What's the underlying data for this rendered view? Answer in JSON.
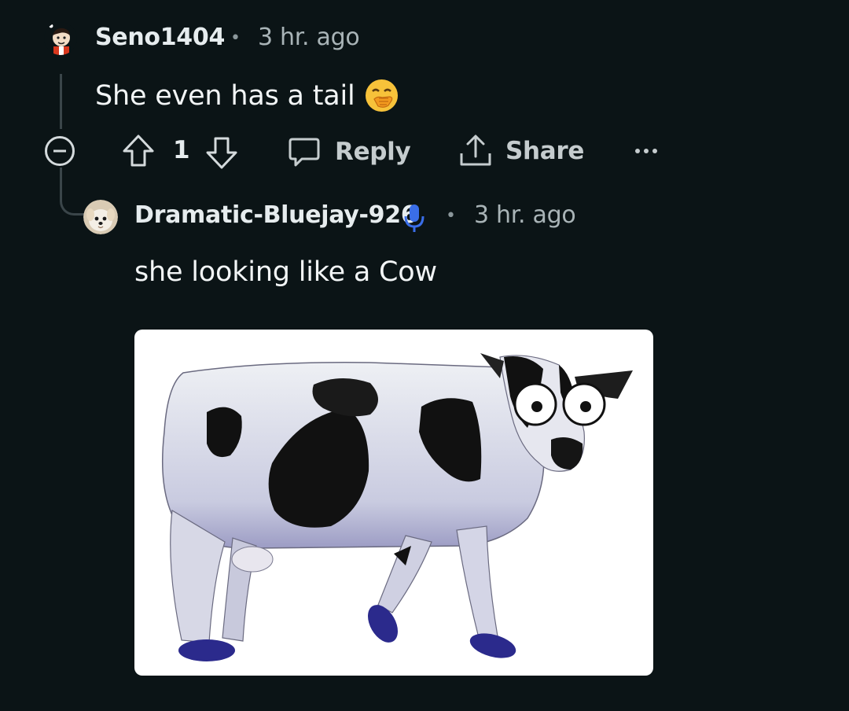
{
  "comment": {
    "username": "Seno1404",
    "separator": "•",
    "time": "3 hr. ago",
    "text": "She even has a tail",
    "emoji": "hand-over-mouth-face-icon",
    "vote_count": "1",
    "reply_label": "Reply",
    "share_label": "Share"
  },
  "reply": {
    "username": "Dramatic-Bluejay-926",
    "separator": "•",
    "time": "3 hr. ago",
    "text": "she looking like a Cow",
    "badge_icon": "microphone-icon",
    "image": "cow-image"
  },
  "colors": {
    "background": "#0b1416",
    "mic_badge": "#3a6ee8",
    "emoji": "#f7c23a"
  }
}
